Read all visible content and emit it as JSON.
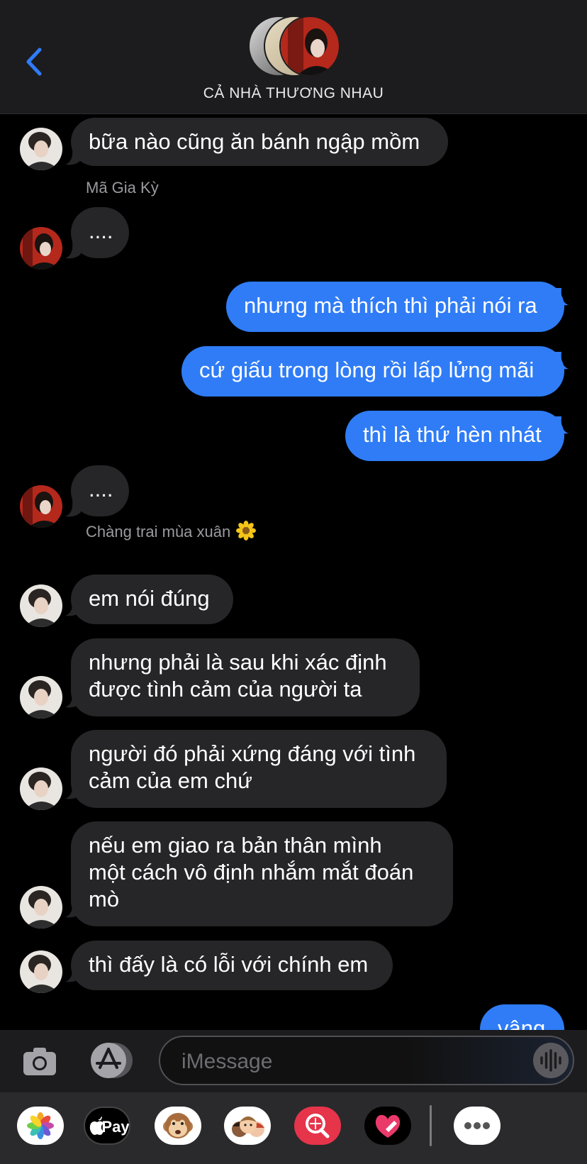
{
  "header": {
    "title": "CẢ NHÀ THƯƠNG NHAU"
  },
  "messages": [
    {
      "text": "bữa nào cũng ăn bánh ngập mồm"
    },
    {
      "sender": "Mã Gia Kỳ",
      "text": "...."
    },
    {
      "text": "nhưng mà thích thì phải nói ra"
    },
    {
      "text": "cứ giấu trong lòng rồi lấp lửng mãi"
    },
    {
      "text": "thì là thứ hèn nhát"
    },
    {
      "text": "...."
    },
    {
      "sender": "Chàng trai mùa xuân",
      "text": "em nói đúng"
    },
    {
      "line1": "nhưng phải là sau khi xác định",
      "line2": "được tình cảm của người ta"
    },
    {
      "line1": "người đó phải xứng đáng với tình",
      "line2": "cảm của em chứ"
    },
    {
      "line1": "nếu em giao ra bản thân mình",
      "line2": "một cách vô định nhắm mắt đoán",
      "line3": "mò"
    },
    {
      "text": "thì đấy là có lỗi với chính em"
    },
    {
      "text": "vâng"
    }
  ],
  "composer": {
    "placeholder": "iMessage"
  },
  "app_strip": {
    "apple_pay_label": "Pay"
  },
  "colors": {
    "outgoing": "#2f7cf6",
    "incoming": "#262628",
    "header": "#1c1c1e"
  }
}
